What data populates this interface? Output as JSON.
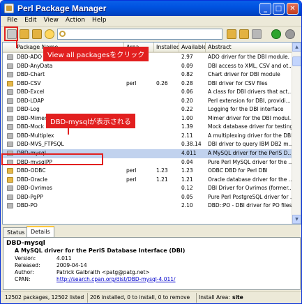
{
  "window": {
    "title": "Perl Package Manager"
  },
  "menu": {
    "items": [
      "File",
      "Edit",
      "View",
      "Action",
      "Help"
    ]
  },
  "toolbar": {
    "search_value": ""
  },
  "table": {
    "headers": {
      "package": "Package Name",
      "area": "Area",
      "installed": "Installed",
      "available": "Available",
      "abstract": "Abstract"
    },
    "rows": [
      {
        "name": "DBD-ADO",
        "area": "",
        "installed": "",
        "available": "2.97",
        "abstract": "ADO driver for the DBI module.",
        "icon": "package-icon"
      },
      {
        "name": "DBD-AnyData",
        "area": "",
        "installed": "",
        "available": "0.09",
        "abstract": "DBI access to XML, CSV and ot...",
        "icon": "package-icon"
      },
      {
        "name": "DBD-Chart",
        "area": "",
        "installed": "",
        "available": "0.82",
        "abstract": "Chart driver for DBI module",
        "icon": "package-icon"
      },
      {
        "name": "DBD-CSV",
        "area": "perl",
        "installed": "0.26",
        "available": "0.28",
        "abstract": "DBI driver for CSV files",
        "icon": "installed-package-icon"
      },
      {
        "name": "DBD-Excel",
        "area": "",
        "installed": "",
        "available": "0.06",
        "abstract": "A class for DBI drivers that act...",
        "icon": "package-icon"
      },
      {
        "name": "DBD-LDAP",
        "area": "",
        "installed": "",
        "available": "0.20",
        "abstract": "Perl extension for DBI, providi...",
        "icon": "package-icon"
      },
      {
        "name": "DBD-Log",
        "area": "",
        "installed": "",
        "available": "0.22",
        "abstract": "Logging for the DBI interface",
        "icon": "package-icon"
      },
      {
        "name": "DBD-Mimer",
        "area": "",
        "installed": "",
        "available": "1.00",
        "abstract": "Mimer driver for the DBI modul...",
        "icon": "package-icon"
      },
      {
        "name": "DBD-Mock",
        "area": "",
        "installed": "",
        "available": "1.39",
        "abstract": "Mock database driver for testing",
        "icon": "package-icon"
      },
      {
        "name": "DBD-Multiplex",
        "area": "",
        "installed": "",
        "available": "2.11",
        "abstract": "A multiplexing driver for the DBI.",
        "icon": "package-icon"
      },
      {
        "name": "DBD-MVS_FTPSQL",
        "area": "",
        "installed": "",
        "available": "0.38.14",
        "abstract": "DBI driver to query IBM DB2 m...",
        "icon": "package-icon"
      },
      {
        "name": "DBD-mysql",
        "area": "",
        "installed": "",
        "available": "4.011",
        "abstract": "A MySQL driver for the PerlS D...",
        "icon": "package-icon",
        "selected": true
      },
      {
        "name": "DBD-mysqlPP",
        "area": "",
        "installed": "",
        "available": "0.04",
        "abstract": "Pure Perl MySQL driver for the ...",
        "icon": "package-icon"
      },
      {
        "name": "DBD-ODBC",
        "area": "perl",
        "installed": "1.23",
        "available": "1.23",
        "abstract": "ODBC DBD for Perl DBI",
        "icon": "installed-package-icon"
      },
      {
        "name": "DBD-Oracle",
        "area": "perl",
        "installed": "1.21",
        "available": "1.21",
        "abstract": "Oracle database driver for the ...",
        "icon": "installed-package-icon"
      },
      {
        "name": "DBD-Ovrimos",
        "area": "",
        "installed": "",
        "available": "0.12",
        "abstract": "DBI Driver for Ovrimos (former...",
        "icon": "package-icon"
      },
      {
        "name": "DBD-PgPP",
        "area": "",
        "installed": "",
        "available": "0.05",
        "abstract": "Pure Perl PostgreSQL driver for ...",
        "icon": "package-icon"
      },
      {
        "name": "DBD-PO",
        "area": "",
        "installed": "",
        "available": "2.10",
        "abstract": "DBD::PO - DBI driver for PO files",
        "icon": "package-icon"
      }
    ]
  },
  "tabs": [
    "Status",
    "Details"
  ],
  "details": {
    "title": "DBD-mysql",
    "abstract": "A MySQL driver for the PerlS Database Interface (DBI)",
    "fields": [
      {
        "label": "Version:",
        "value": "4.011"
      },
      {
        "label": "Released:",
        "value": "2009-04-14"
      },
      {
        "label": "Author:",
        "value": "Patrick Galbraith <patg@patg.net>"
      },
      {
        "label": "CPAN:",
        "value": "http://search.cpan.org/dist/DBD-mysql-4.011/"
      }
    ]
  },
  "status": {
    "packages": "12502 packages, 12502 listed",
    "counts": "206 installed, 0 to install, 0 to remove",
    "area_label": "Install Area:",
    "area_value": "site"
  },
  "annotations": {
    "callout1": "View all packagesをクリック",
    "callout2": "DBD-mysqlが表示される"
  },
  "colors": {
    "annotation": "#e21f1f",
    "selection": "#c1d2ee",
    "titlebar": "#0053e1"
  }
}
